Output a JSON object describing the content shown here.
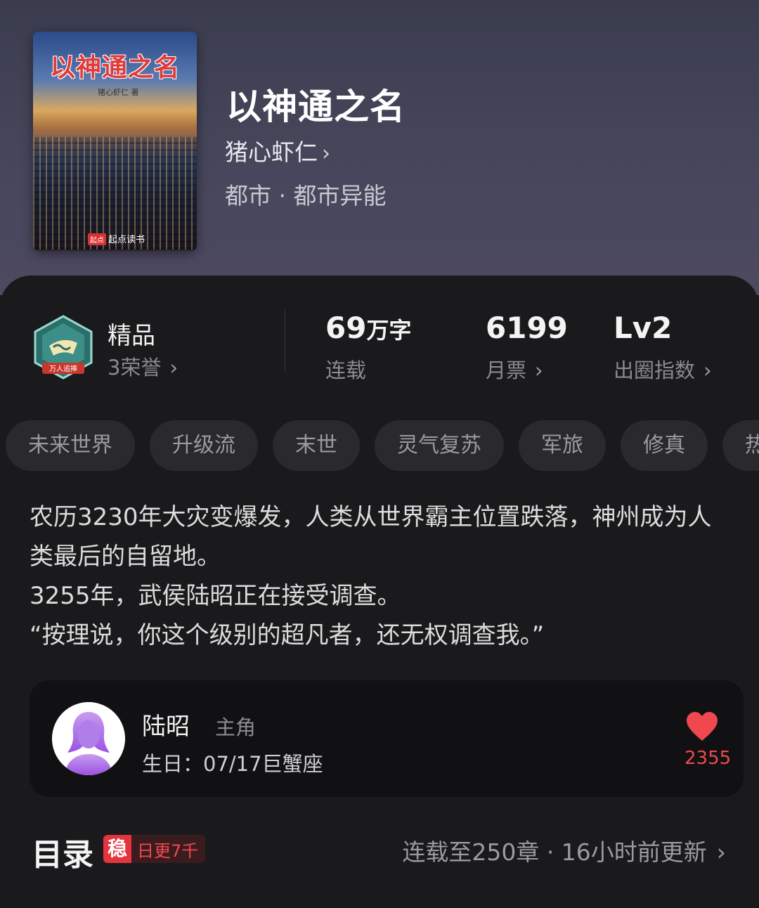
{
  "book": {
    "cover": {
      "title": "以神通之名",
      "author": "猪心虾仁 著",
      "publisher_mark": "起点",
      "publisher": "起点读书"
    },
    "title": "以神通之名",
    "author": "猪心虾仁",
    "genre": "都市 · 都市异能"
  },
  "stats": {
    "quality": {
      "label": "精品",
      "honor": "3荣誉",
      "badge_text": "万人追捧"
    },
    "words": {
      "value": "69",
      "unit": "万字",
      "sub": "连载"
    },
    "monthly_votes": {
      "value": "6199",
      "sub": "月票"
    },
    "circle_index": {
      "value": "Lv2",
      "sub": "出圈指数"
    }
  },
  "tags": [
    "未来世界",
    "升级流",
    "末世",
    "灵气复苏",
    "军旅",
    "修真",
    "热血"
  ],
  "description": [
    "农历3230年大灾变爆发，人类从世界霸主位置跌落，神州成为人类最后的自留地。",
    "3255年，武侯陆昭正在接受调查。",
    "“按理说，你这个级别的超凡者，还无权调查我。”"
  ],
  "character": {
    "name": "陆昭",
    "role": "主角",
    "birthday": "生日：07/17巨蟹座",
    "likes": "2355"
  },
  "toc": {
    "title": "目录",
    "stable_badge": "稳",
    "update_rate": "日更7千",
    "status": "连载至250章 · 16小时前更新"
  },
  "icons": {
    "chevron": "chevron-right-icon",
    "heart": "heart-icon",
    "badge": "quality-badge-icon"
  },
  "colors": {
    "accent_red": "#e5343e",
    "like_red": "#f0484f",
    "background": "#1a1a1c",
    "header": "#45455a"
  }
}
